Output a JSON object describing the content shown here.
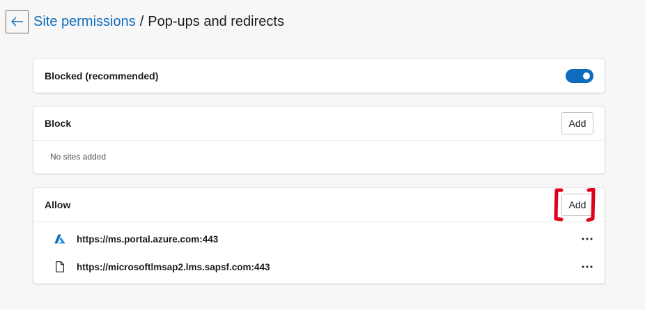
{
  "header": {
    "back_icon": "arrow-left-icon",
    "breadcrumb_parent": "Site permissions",
    "breadcrumb_separator": "/",
    "breadcrumb_current": "Pop-ups and redirects"
  },
  "blocked_setting": {
    "label": "Blocked (recommended)",
    "enabled": true
  },
  "block_section": {
    "title": "Block",
    "add_label": "Add",
    "empty_text": "No sites added"
  },
  "allow_section": {
    "title": "Allow",
    "add_label": "Add",
    "sites": [
      {
        "url": "https://ms.portal.azure.com:443",
        "icon": "azure-logo-icon"
      },
      {
        "url": "https://microsoftlmsap2.lms.sapsf.com:443",
        "icon": "document-icon"
      }
    ]
  },
  "colors": {
    "accent": "#0f6cbd",
    "highlight": "#e0001b",
    "background": "#f7f7f7"
  }
}
